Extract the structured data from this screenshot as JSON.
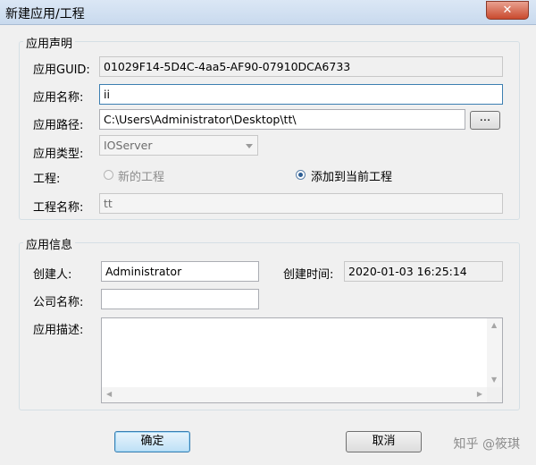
{
  "window": {
    "title": "新建应用/工程",
    "close_icon": "✕"
  },
  "app_declaration": {
    "group_title": "应用声明",
    "guid_label": "应用GUID:",
    "guid_value": "01029F14-5D4C-4aa5-AF90-07910DCA6733",
    "name_label": "应用名称:",
    "name_value": "ii",
    "path_label": "应用路径:",
    "path_value": "C:\\Users\\Administrator\\Desktop\\tt\\",
    "browse_label": "...",
    "type_label": "应用类型:",
    "type_value": "IOServer",
    "project_label": "工程:",
    "radio_new_label": "新的工程",
    "radio_add_label": "添加到当前工程",
    "radio_selected": "添加到当前工程",
    "project_name_label": "工程名称:",
    "project_name_value": "tt"
  },
  "app_info": {
    "group_title": "应用信息",
    "creator_label": "创建人:",
    "creator_value": "Administrator",
    "created_time_label": "创建时间:",
    "created_time_value": "2020-01-03 16:25:14",
    "company_label": "公司名称:",
    "company_value": "",
    "description_label": "应用描述:",
    "description_value": ""
  },
  "buttons": {
    "ok_label": "确定",
    "cancel_label": "取消"
  },
  "watermark": "知乎 @筱琪"
}
